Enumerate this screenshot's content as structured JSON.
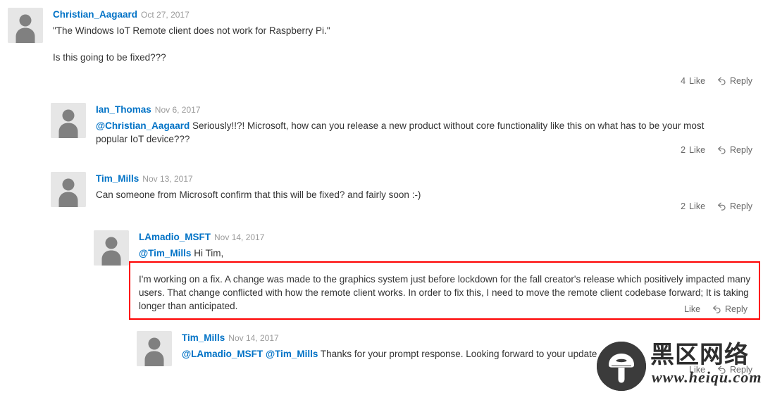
{
  "thread": {
    "comments": [
      {
        "id": "c1",
        "author": "Christian_Aagaard",
        "date": "Oct 27, 2017",
        "mentions": [],
        "paragraphs": [
          "\"The Windows IoT Remote client does not work for Raspberry Pi.\"",
          "Is this going to be fixed???"
        ],
        "like_count": "4",
        "like_label": "Like",
        "reply_label": "Reply",
        "avatar_icon": "user-avatar-icon",
        "reply_icon": "reply-arrow-icon"
      },
      {
        "id": "c2",
        "author": "Ian_Thomas",
        "date": "Nov 6, 2017",
        "mentions": [
          "@Christian_Aagaard"
        ],
        "paragraphs": [
          "Seriously!!?!  Microsoft, how can you release a new product without core functionality like this on what has to be your most popular IoT device???"
        ],
        "like_count": "2",
        "like_label": "Like",
        "reply_label": "Reply",
        "avatar_icon": "user-avatar-icon",
        "reply_icon": "reply-arrow-icon"
      },
      {
        "id": "c3",
        "author": "Tim_Mills",
        "date": "Nov 13, 2017",
        "mentions": [],
        "paragraphs": [
          "Can someone from Microsoft confirm that this will be fixed? and fairly soon :-)"
        ],
        "like_count": "2",
        "like_label": "Like",
        "reply_label": "Reply",
        "avatar_icon": "user-avatar-icon",
        "reply_icon": "reply-arrow-icon"
      },
      {
        "id": "c4",
        "author": "LAmadio_MSFT",
        "date": "Nov 14, 2017",
        "mentions": [
          "@Tim_Mills"
        ],
        "paragraphs": [
          "Hi Tim,",
          "I'm working on a fix. A change was made to the graphics system just before lockdown for the fall creator's release which positively impacted many users. That change conflicted with how the remote client works. In order to fix this, I need to move the remote client codebase forward; It is taking longer than anticipated."
        ],
        "like_count": "",
        "like_label": "Like",
        "reply_label": "Reply",
        "avatar_icon": "user-avatar-icon",
        "reply_icon": "reply-arrow-icon",
        "highlighted": true
      },
      {
        "id": "c5",
        "author": "Tim_Mills",
        "date": "Nov 14, 2017",
        "mentions": [
          "@LAmadio_MSFT",
          "@Tim_Mills"
        ],
        "paragraphs": [
          "Thanks for your prompt response.  Looking forward to your update ... le :-D"
        ],
        "like_count": "",
        "like_label": "Like",
        "reply_label": "Reply",
        "avatar_icon": "user-avatar-icon",
        "reply_icon": "reply-arrow-icon"
      }
    ]
  },
  "watermark": {
    "brand_cn": "黑区网络",
    "url": "www.heiqu.com",
    "logo_icon": "mushroom-logo-icon"
  },
  "colors": {
    "author_link": "#0072c6",
    "highlight_border": "#fe0000",
    "body_text": "#333333",
    "date_text": "#9a9a9a",
    "avatar_bg": "#e6e6e6",
    "action_text": "#666666"
  }
}
